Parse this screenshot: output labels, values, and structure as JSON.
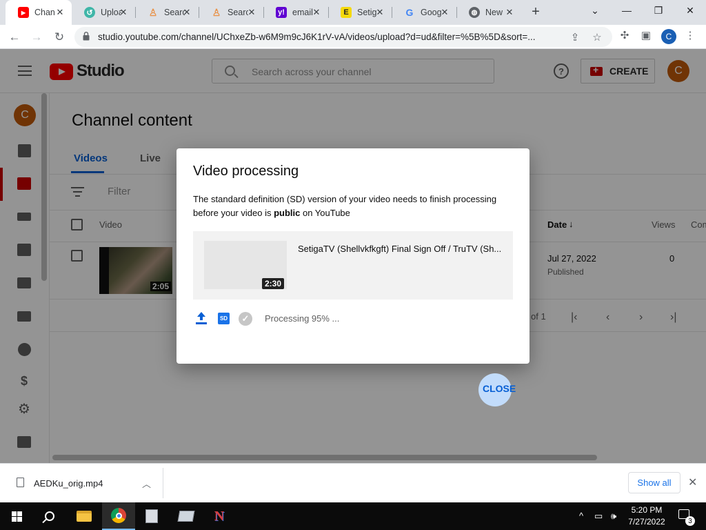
{
  "browser": {
    "tabs": [
      {
        "title": "Chann",
        "icon": "youtube-studio-icon",
        "active": true
      },
      {
        "title": "Uploa",
        "icon": "upload-site-icon"
      },
      {
        "title": "Searc",
        "icon": "person-search-icon"
      },
      {
        "title": "Searc",
        "icon": "person-search-icon"
      },
      {
        "title": "email",
        "icon": "yahoo-icon"
      },
      {
        "title": "Setig",
        "icon": "e-site-icon"
      },
      {
        "title": "Goog",
        "icon": "google-icon"
      },
      {
        "title": "New",
        "icon": "globe-icon"
      }
    ],
    "url": "studio.youtube.com/channel/UChxeZb-w6M9m9cJ6K1rV-vA/videos/upload?d=ud&filter=%5B%5D&sort=...",
    "profile_initial": "C"
  },
  "studio": {
    "logo_text": "Studio",
    "search_placeholder": "Search across your channel",
    "create_label": "CREATE",
    "avatar_initial": "C",
    "page_title": "Channel content",
    "tabs": [
      "Videos",
      "Live"
    ],
    "filter_placeholder": "Filter",
    "columns": {
      "video": "Video",
      "date": "Date",
      "views": "Views",
      "comments": "Com"
    },
    "row": {
      "duration": "2:05",
      "date": "Jul 27, 2022",
      "status": "Published",
      "views": "0"
    },
    "pagination": "of 1"
  },
  "dialog": {
    "title": "Video processing",
    "message_before": "The standard definition (SD) version of your video needs to finish processing before your video is ",
    "message_bold": "public",
    "message_after": " on YouTube",
    "video_title": "SetigaTV (Shellvkfkgft) Final Sign Off / TruTV (Sh...",
    "video_duration": "2:30",
    "status_text": "Processing 95% ...",
    "processing_percent": 95,
    "sd_badge": "SD",
    "close_label": "CLOSE"
  },
  "downloads": {
    "file_name": "AEDKu_orig.mp4",
    "show_all": "Show all"
  },
  "taskbar": {
    "time": "5:20 PM",
    "date": "7/27/2022",
    "notification_count": "3"
  },
  "colors": {
    "youtube_red": "#ff0000",
    "accent_blue": "#065fd4",
    "avatar_orange": "#c25a0a"
  }
}
